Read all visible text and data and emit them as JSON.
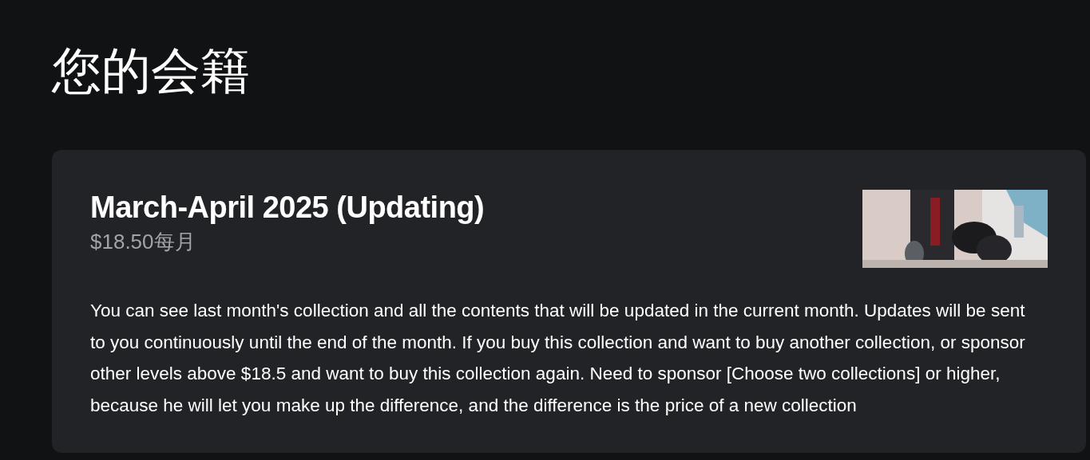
{
  "page": {
    "title": "您的会籍"
  },
  "membership": {
    "name": "March-April 2025 (Updating)",
    "price": "$18.50每月",
    "description": "You can see last month's collection and all the contents that will be updated in the current month. Updates will be sent to you continuously until the end of the month. If you buy this collection and want to buy another collection, or sponsor other levels above $18.5 and want to buy this collection again. Need to sponsor [Choose two collections] or higher, because he will let you make up the difference, and the difference is the price of a new collection"
  }
}
